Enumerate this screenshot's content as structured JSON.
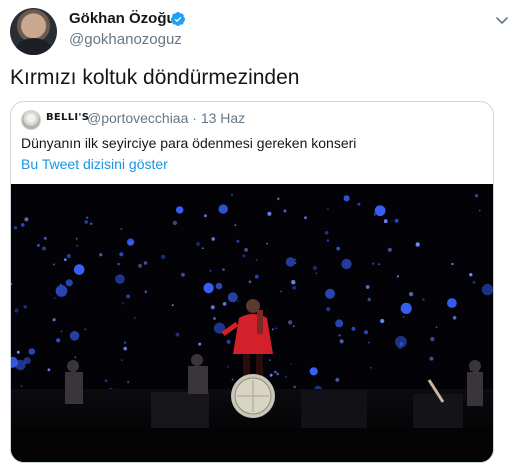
{
  "tweet": {
    "author_name": "Gökhan Özoğuz",
    "author_handle": "@gokhanozoguz",
    "text": "Kırmızı koltuk döndürmezinden"
  },
  "quoted_tweet": {
    "author_name": "BELLI'S",
    "author_handle": "@portovecchiaa · 13 Haz",
    "text": "Dünyanın ilk seyirciye para ödenmesi gereken konseri",
    "thread_link": "Bu Tweet dizisini göster"
  },
  "icons": {
    "verified": "verified-badge-icon",
    "more": "chevron-down-icon",
    "media": "concert-video-thumbnail"
  },
  "colors": {
    "link": "#1b95e0",
    "verified": "#1da1f2",
    "secondary_text": "#657786",
    "stage_lights": "#2a4fd8"
  }
}
